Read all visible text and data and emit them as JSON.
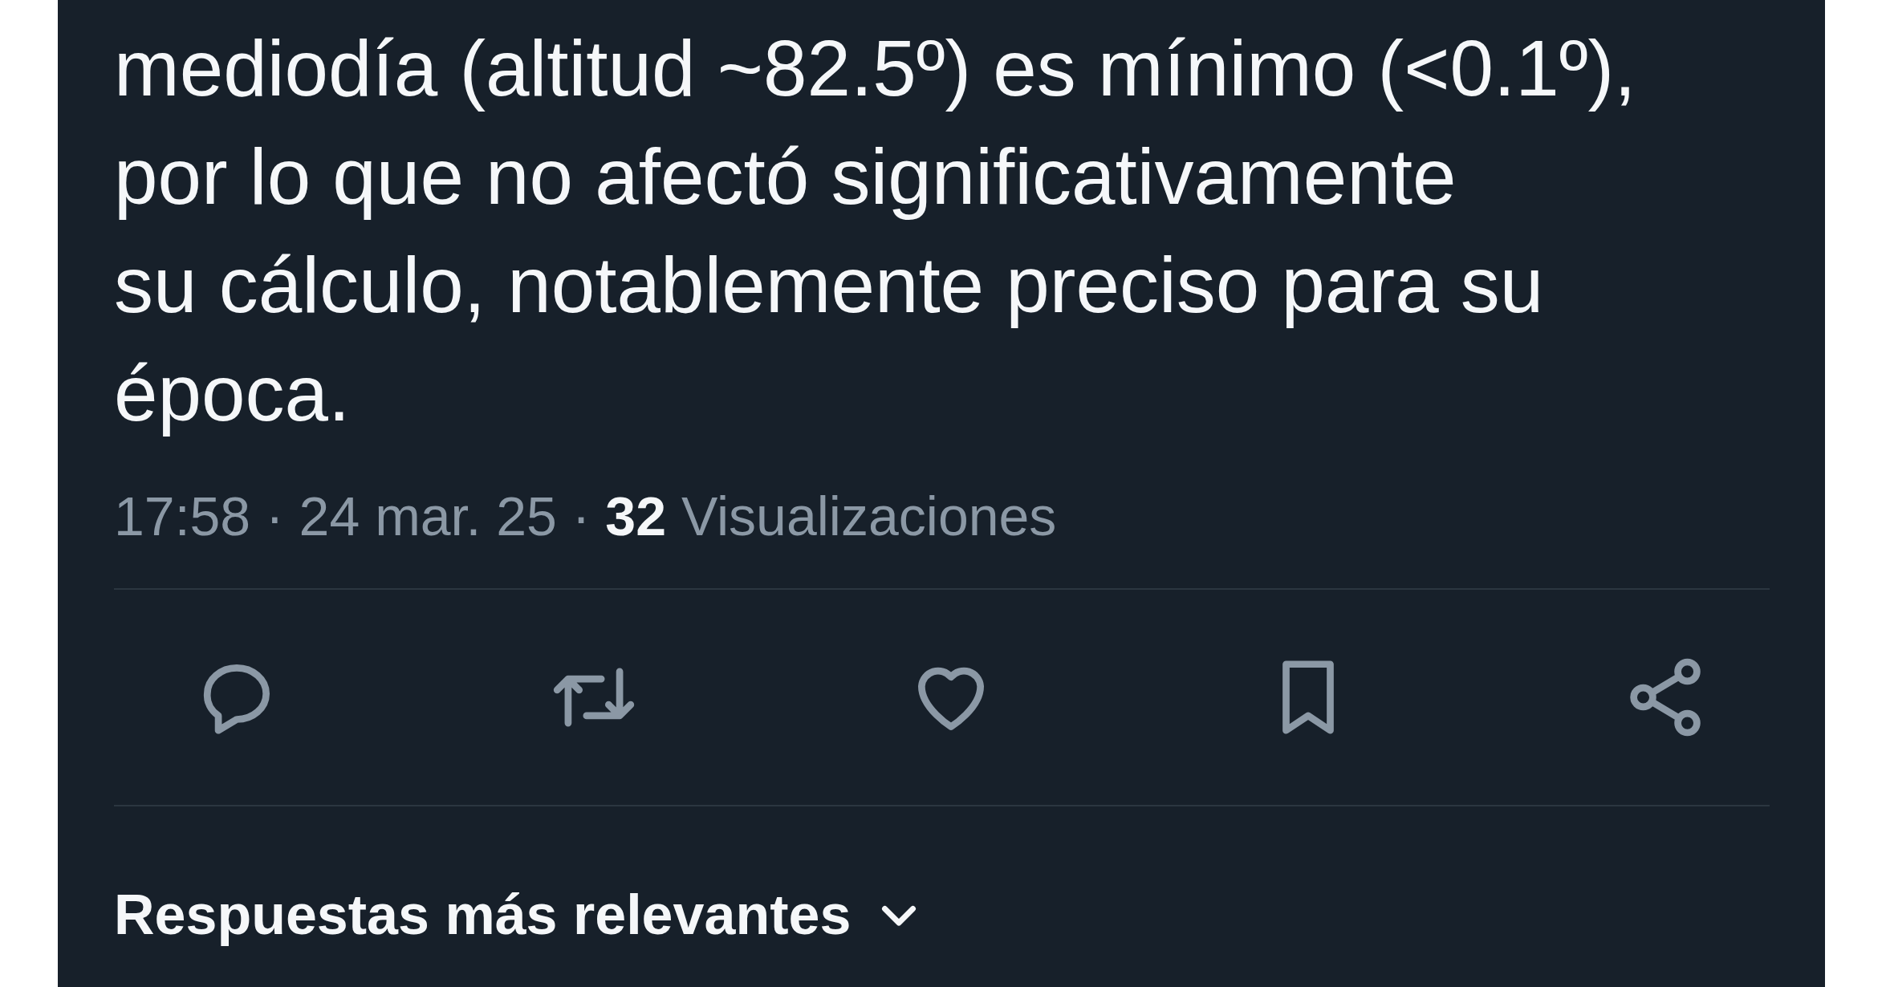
{
  "tweet": {
    "text": "mediodía (altitud ~82.5º) es mínimo (<0.1º),\npor lo que no afectó significativamente\nsu cálculo, notablemente preciso para su\népoca.",
    "meta": "17:58 · 24 mar. 25 · **32** Visualizaciones"
  },
  "actions": [
    {
      "kind": "reply"
    },
    {
      "kind": "repost"
    },
    {
      "kind": "like"
    },
    {
      "kind": "bookmark"
    },
    {
      "kind": "share"
    }
  ],
  "replies_sort": {
    "label": "Respuestas más relevantes"
  }
}
